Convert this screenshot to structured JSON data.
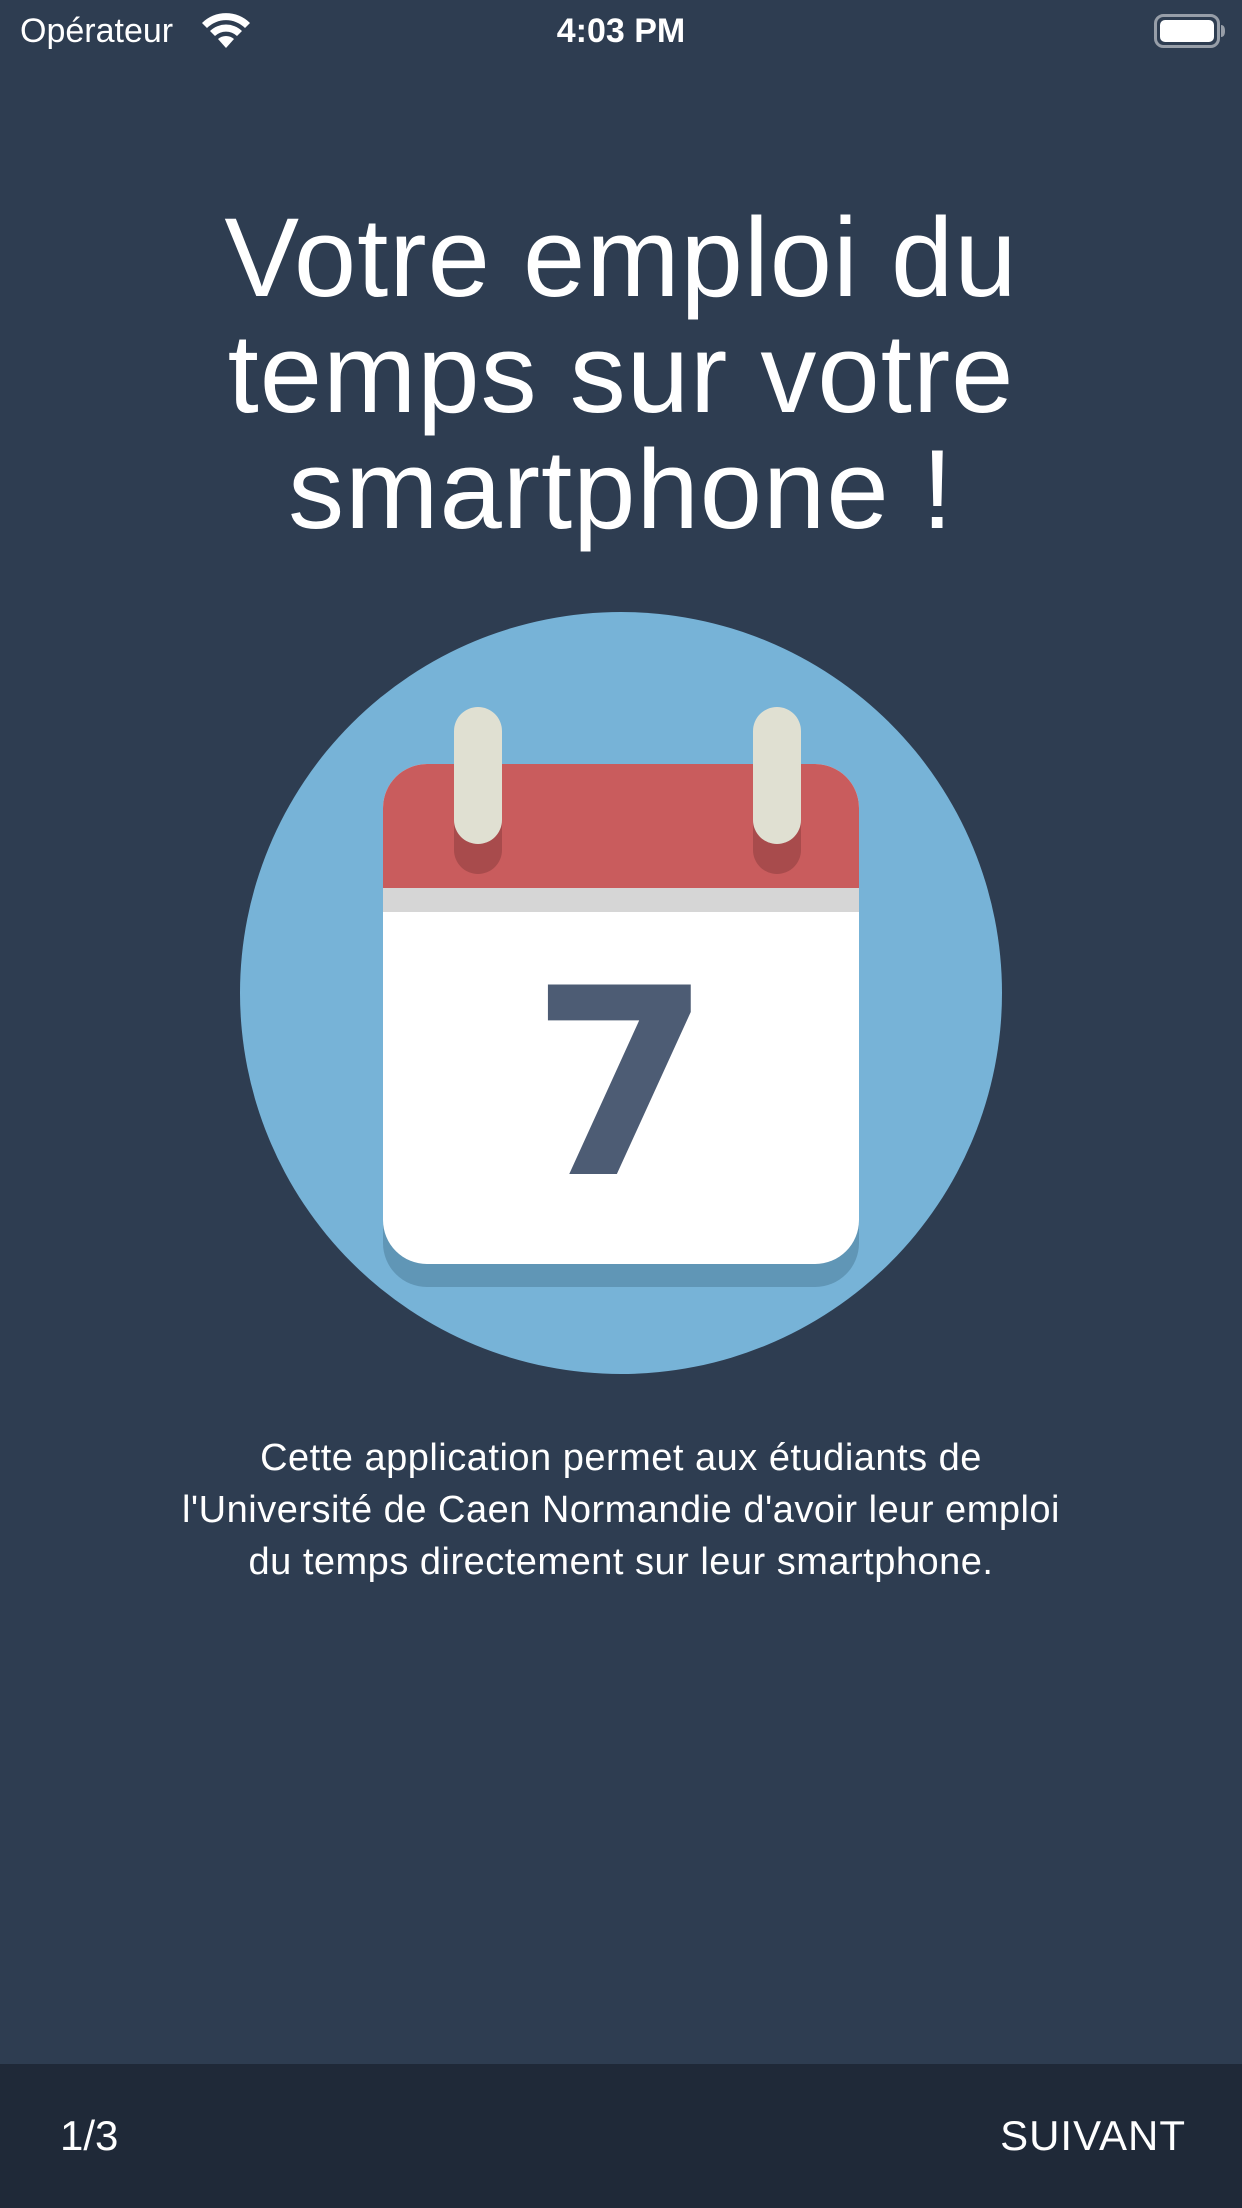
{
  "status_bar": {
    "carrier": "Opérateur",
    "time": "4:03 PM",
    "icons": [
      "wifi-icon",
      "battery-icon"
    ]
  },
  "onboarding": {
    "title": "Votre emploi du\ntemps sur votre\nsmartphone !",
    "illustration": {
      "icon": "calendar-icon",
      "day_number": "7"
    },
    "description": "Cette application permet aux étudiants de\nl'Université de Caen Normandie d'avoir leur emploi\ndu temps directement sur leur smartphone."
  },
  "footer": {
    "page_indicator": "1/3",
    "next_label": "SUIVANT"
  },
  "colors": {
    "background": "#2e3d51",
    "footer_background": "#1f2938",
    "circle": "#77b3d7",
    "calendar_header": "#c95c5d",
    "calendar_rings": "#e0e0d2",
    "calendar_digit": "#4d5c74"
  }
}
